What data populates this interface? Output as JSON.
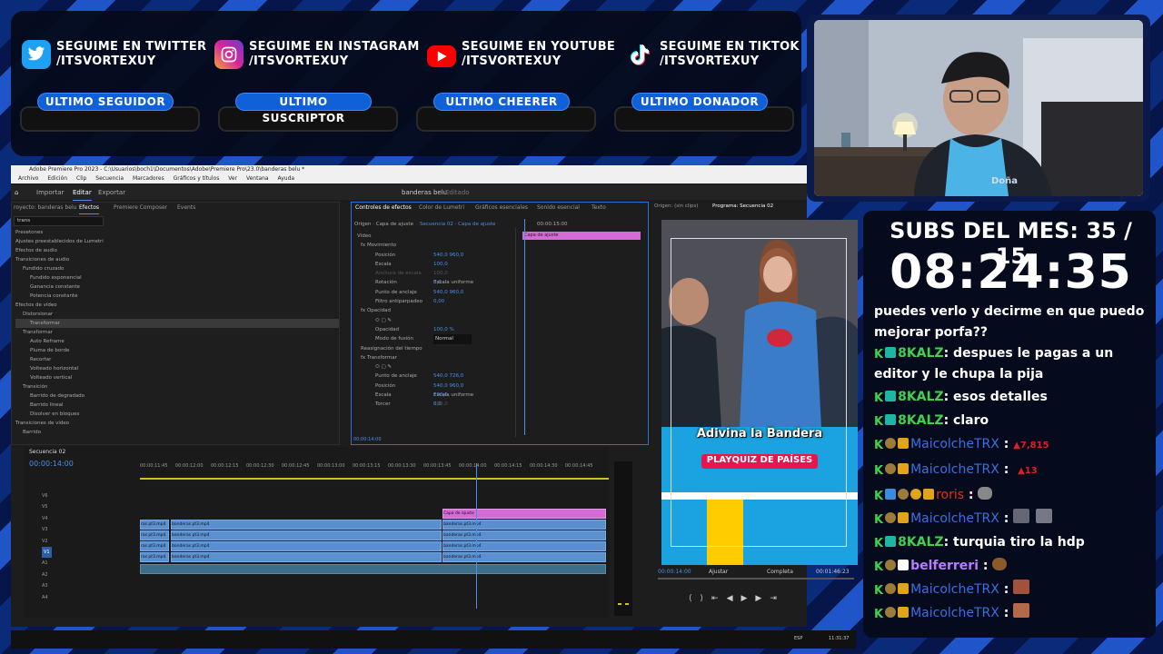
{
  "social": [
    {
      "icon": "twitter-icon",
      "line1": "SEGUIME EN TWITTER",
      "line2": "/ITSVORTEXUY",
      "color": "#1da1f2"
    },
    {
      "icon": "instagram-icon",
      "line1": "SEGUIME EN INSTAGRAM",
      "line2": "/ITSVORTEXUY",
      "color": "#d6249f"
    },
    {
      "icon": "youtube-icon",
      "line1": "SEGUIME EN YOUTUBE",
      "line2": "/ITSVORTEXUY",
      "color": "#ff0000"
    },
    {
      "icon": "tiktok-icon",
      "line1": "SEGUIME EN TIKTOK",
      "line2": "/ITSVORTEXUY",
      "color": "#000000"
    }
  ],
  "labels": [
    "ULTIMO SEGUIDOR",
    "ULTIMO SUSCRIPTOR",
    "ULTIMO CHEERER",
    "ULTIMO DONADOR"
  ],
  "subs": {
    "header": "SUBS DEL MES: 35 / 15",
    "timer": "08:24:35"
  },
  "chat": [
    {
      "user": "",
      "text": "puedes verlo y decirme en que puedo mejorar porfa??",
      "ucolor": "#ffffff"
    },
    {
      "user": "8KALZ",
      "text": ": despues le pagas a un editor y le chupa la pija",
      "ucolor": "#3ed34a"
    },
    {
      "user": "8KALZ",
      "text": ": esos detalles",
      "ucolor": "#3ed34a"
    },
    {
      "user": "8KALZ",
      "text": ": claro",
      "ucolor": "#3ed34a"
    },
    {
      "user": "MaicolcheTRX",
      "text": ":",
      "extra": "7,815",
      "ucolor": "#3b6fe0"
    },
    {
      "user": "MaicolcheTRX",
      "text": ":",
      "extra": "13",
      "ucolor": "#3b6fe0"
    },
    {
      "user": "roris",
      "text": ":",
      "ucolor": "#e0301e"
    },
    {
      "user": "MaicolcheTRX",
      "text": ":",
      "ucolor": "#3b6fe0"
    },
    {
      "user": "8KALZ",
      "text": ": turquia tiro la hdp",
      "ucolor": "#3ed34a"
    },
    {
      "user": "belferreri",
      "text": ":",
      "ucolor": "#b87cff"
    },
    {
      "user": "MaicolcheTRX",
      "text": ":",
      "ucolor": "#3b6fe0"
    },
    {
      "user": "MaicolcheTRX",
      "text": ":",
      "ucolor": "#3b6fe0"
    }
  ],
  "premiere": {
    "title": "Adobe Premiere Pro 2023 - C:\\Usuarios\\boch1\\Documentos\\Adobe\\Premiere Pro\\23.0\\banderas belu *",
    "menu": [
      "Archivo",
      "Edición",
      "Clip",
      "Secuencia",
      "Marcadores",
      "Gráficos y títulos",
      "Ver",
      "Ventana",
      "Ayuda"
    ],
    "workspace": [
      "Inicio",
      "Importar",
      "Editar",
      "Exportar"
    ],
    "project_name": "banderas belu",
    "edit_state": "Editado",
    "effects_tabs": [
      "royecto: banderas belu",
      "Efectos",
      "Premiere Composer",
      "Events"
    ],
    "search_value": "trans",
    "effects_tree": [
      "Presetones",
      "Ajustes preestablecidos de Lumetri",
      "Efectos de audio",
      "Transiciones de audio",
      "Fundido cruzado",
      "Fundido exponencial",
      "Ganancia constante",
      "Potencia constante",
      "Efectos de vídeo",
      "Distorsionar",
      "Transformar",
      "Transformar",
      "Auto Reframe",
      "Pluma de borde",
      "Recortar",
      "Volteado horizontal",
      "Volteado vertical",
      "Transición",
      "Barrido de degradado",
      "Barrido lineal",
      "Disolver en bloques",
      "Transiciones de vídeo",
      "Barrido"
    ],
    "controls_tabs": [
      "Controles de efectos",
      "Color de Lumetri",
      "Gráficos esenciales",
      "Sonido esencial",
      "Texto"
    ],
    "source_line": "Origen · Capa de ajuste",
    "seq_line": "Secuencia 02 · Capa de ajuste",
    "tl_time": "00:00:15:00",
    "clip_label": "Capa de ajuste",
    "fx_rows": [
      {
        "l": "Vídeo",
        "v": ""
      },
      {
        "l": "fx Movimiento",
        "v": ""
      },
      {
        "l": "Posición",
        "v": "540,0    960,0"
      },
      {
        "l": "Escala",
        "v": "100,0"
      },
      {
        "l": "Anchura de escala",
        "v": "100,0"
      },
      {
        "l": "",
        "v": "Escala uniforme"
      },
      {
        "l": "Rotación",
        "v": "0,0"
      },
      {
        "l": "Punto de anclaje",
        "v": "540,0    960,0"
      },
      {
        "l": "Filtro antiparpadeo",
        "v": "0,00"
      },
      {
        "l": "fx Opacidad",
        "v": ""
      },
      {
        "l": "",
        "v": ""
      },
      {
        "l": "Opacidad",
        "v": "100,0 %"
      },
      {
        "l": "Modo de fusión",
        "v": "Normal"
      },
      {
        "l": "Reasignación del tiempo",
        "v": ""
      },
      {
        "l": "fx Transformar",
        "v": ""
      },
      {
        "l": "",
        "v": ""
      },
      {
        "l": "Punto de anclaje",
        "v": "540,0    726,0"
      },
      {
        "l": "Posición",
        "v": "540,0    960,0"
      },
      {
        "l": "",
        "v": "Escala uniforme"
      },
      {
        "l": "Escala",
        "v": "100,0"
      },
      {
        "l": "",
        "v": "100,0"
      },
      {
        "l": "Torcer",
        "v": "0,0"
      }
    ],
    "fx_time": "00:00:14:00",
    "source_tab": "Origen: (sin clips)",
    "program_tab": "Programa: Secuencia 02",
    "preview_title": "Adivina la Bandera",
    "preview_sub": "PLAYQUIZ DE PAÍSES",
    "program_time": "00:00:14:00",
    "fit": "Ajustar",
    "quality": "Completa",
    "duration": "00:01:46:23",
    "seq_tab": "Secuencia 02",
    "seq_time": "00:00:14:00",
    "ruler": [
      "00:00:11:45",
      "00:00:12:00",
      "00:00:12:15",
      "00:00:12:30",
      "00:00:12:45",
      "00:00:13:00",
      "00:00:13:15",
      "00:00:13:30",
      "00:00:13:45",
      "00:00:14:00",
      "00:00:14:15",
      "00:00:14:30",
      "00:00:14:45"
    ],
    "tracks": [
      "V6",
      "V5",
      "V4",
      "V3",
      "V2",
      "V1",
      "A1",
      "A2",
      "A3",
      "A4"
    ],
    "clips_left": [
      "banderas pt3.mp4",
      "banderas pt3.mp4",
      "banderas pt3.mp4",
      "banderas pt3.mp4"
    ],
    "clips_right": [
      "banderas pt3.mp4",
      "banderas pt3.mp4",
      "banderas pt3.mp4",
      "banderas pt3.mp4"
    ],
    "clip_short": [
      "ras pt3.mp4",
      "ras pt3.mp4",
      "ras pt3.mp4",
      "ras pt3.mp4"
    ],
    "adjust_clip": "Capa de ajuste",
    "task_time": "11:31:37",
    "lang": "ESP"
  }
}
